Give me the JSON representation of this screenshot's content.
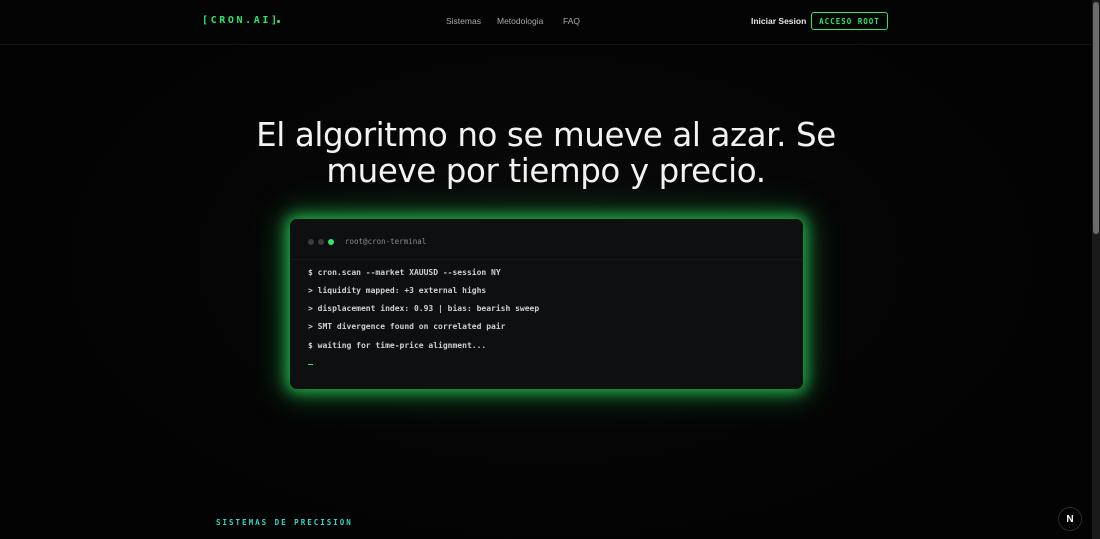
{
  "nav": {
    "logo": "[CRON.AI]",
    "links": [
      "Sistemas",
      "Metodologia",
      "FAQ"
    ],
    "login": "Iniciar Sesion",
    "cta": "ACCESO ROOT"
  },
  "hero": {
    "title_line1": "El algoritmo no se mueve al azar. Se",
    "title_line2": "mueve por tiempo y precio."
  },
  "terminal": {
    "title": "root@cron-terminal",
    "lines": [
      "$ cron.scan --market XAUUSD --session NY",
      "> liquidity mapped: +3 external highs",
      "> displacement index: 0.93 | bias: bearish sweep",
      "> SMT divergence found on correlated pair",
      "$ waiting for time-price alignment..."
    ]
  },
  "section": {
    "label": "SISTEMAS DE PRECISION"
  },
  "floating": {
    "badge": "N"
  },
  "colors": {
    "accent": "#2ee66b",
    "section_label": "#34d6c0",
    "background": "#030303"
  }
}
